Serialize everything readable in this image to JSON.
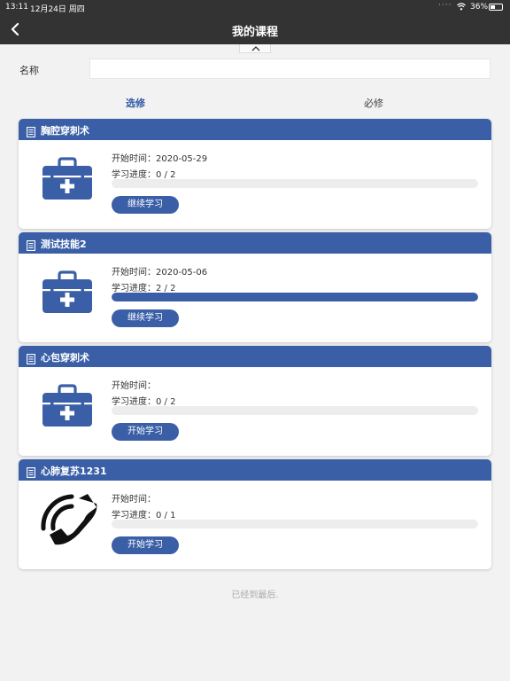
{
  "status_bar": {
    "time": "13:11",
    "date": "12月24日 周四",
    "battery": "36%",
    "battery_fraction": 0.36
  },
  "nav": {
    "title": "我的课程"
  },
  "search": {
    "label": "名称",
    "value": "",
    "placeholder": ""
  },
  "tabs": [
    {
      "label": "选修",
      "active": true
    },
    {
      "label": "必修",
      "active": false
    }
  ],
  "courses": [
    {
      "title": "胸腔穿刺术",
      "icon": "medical-kit-icon",
      "start_time": "开始时间：2020-05-29",
      "progress_text": "学习进度：0 / 2",
      "progress": 0,
      "button": "继续学习"
    },
    {
      "title": "测试技能2",
      "icon": "medical-kit-icon",
      "start_time": "开始时间：2020-05-06",
      "progress_text": "学习进度：2 / 2",
      "progress": 1,
      "button": "继续学习"
    },
    {
      "title": "心包穿刺术",
      "icon": "medical-kit-icon",
      "start_time": "开始时间：",
      "progress_text": "学习进度：0 / 2",
      "progress": 0,
      "button": "开始学习"
    },
    {
      "title": "心肺复苏1231",
      "icon": "phone-icon",
      "start_time": "开始时间：",
      "progress_text": "学习进度：0 / 1",
      "progress": 0,
      "button": "开始学习"
    }
  ],
  "footer": "已经到最后.",
  "colors": {
    "accent": "#3a5fa7",
    "nav_bg": "#333333",
    "page_bg": "#f2f2f2"
  }
}
